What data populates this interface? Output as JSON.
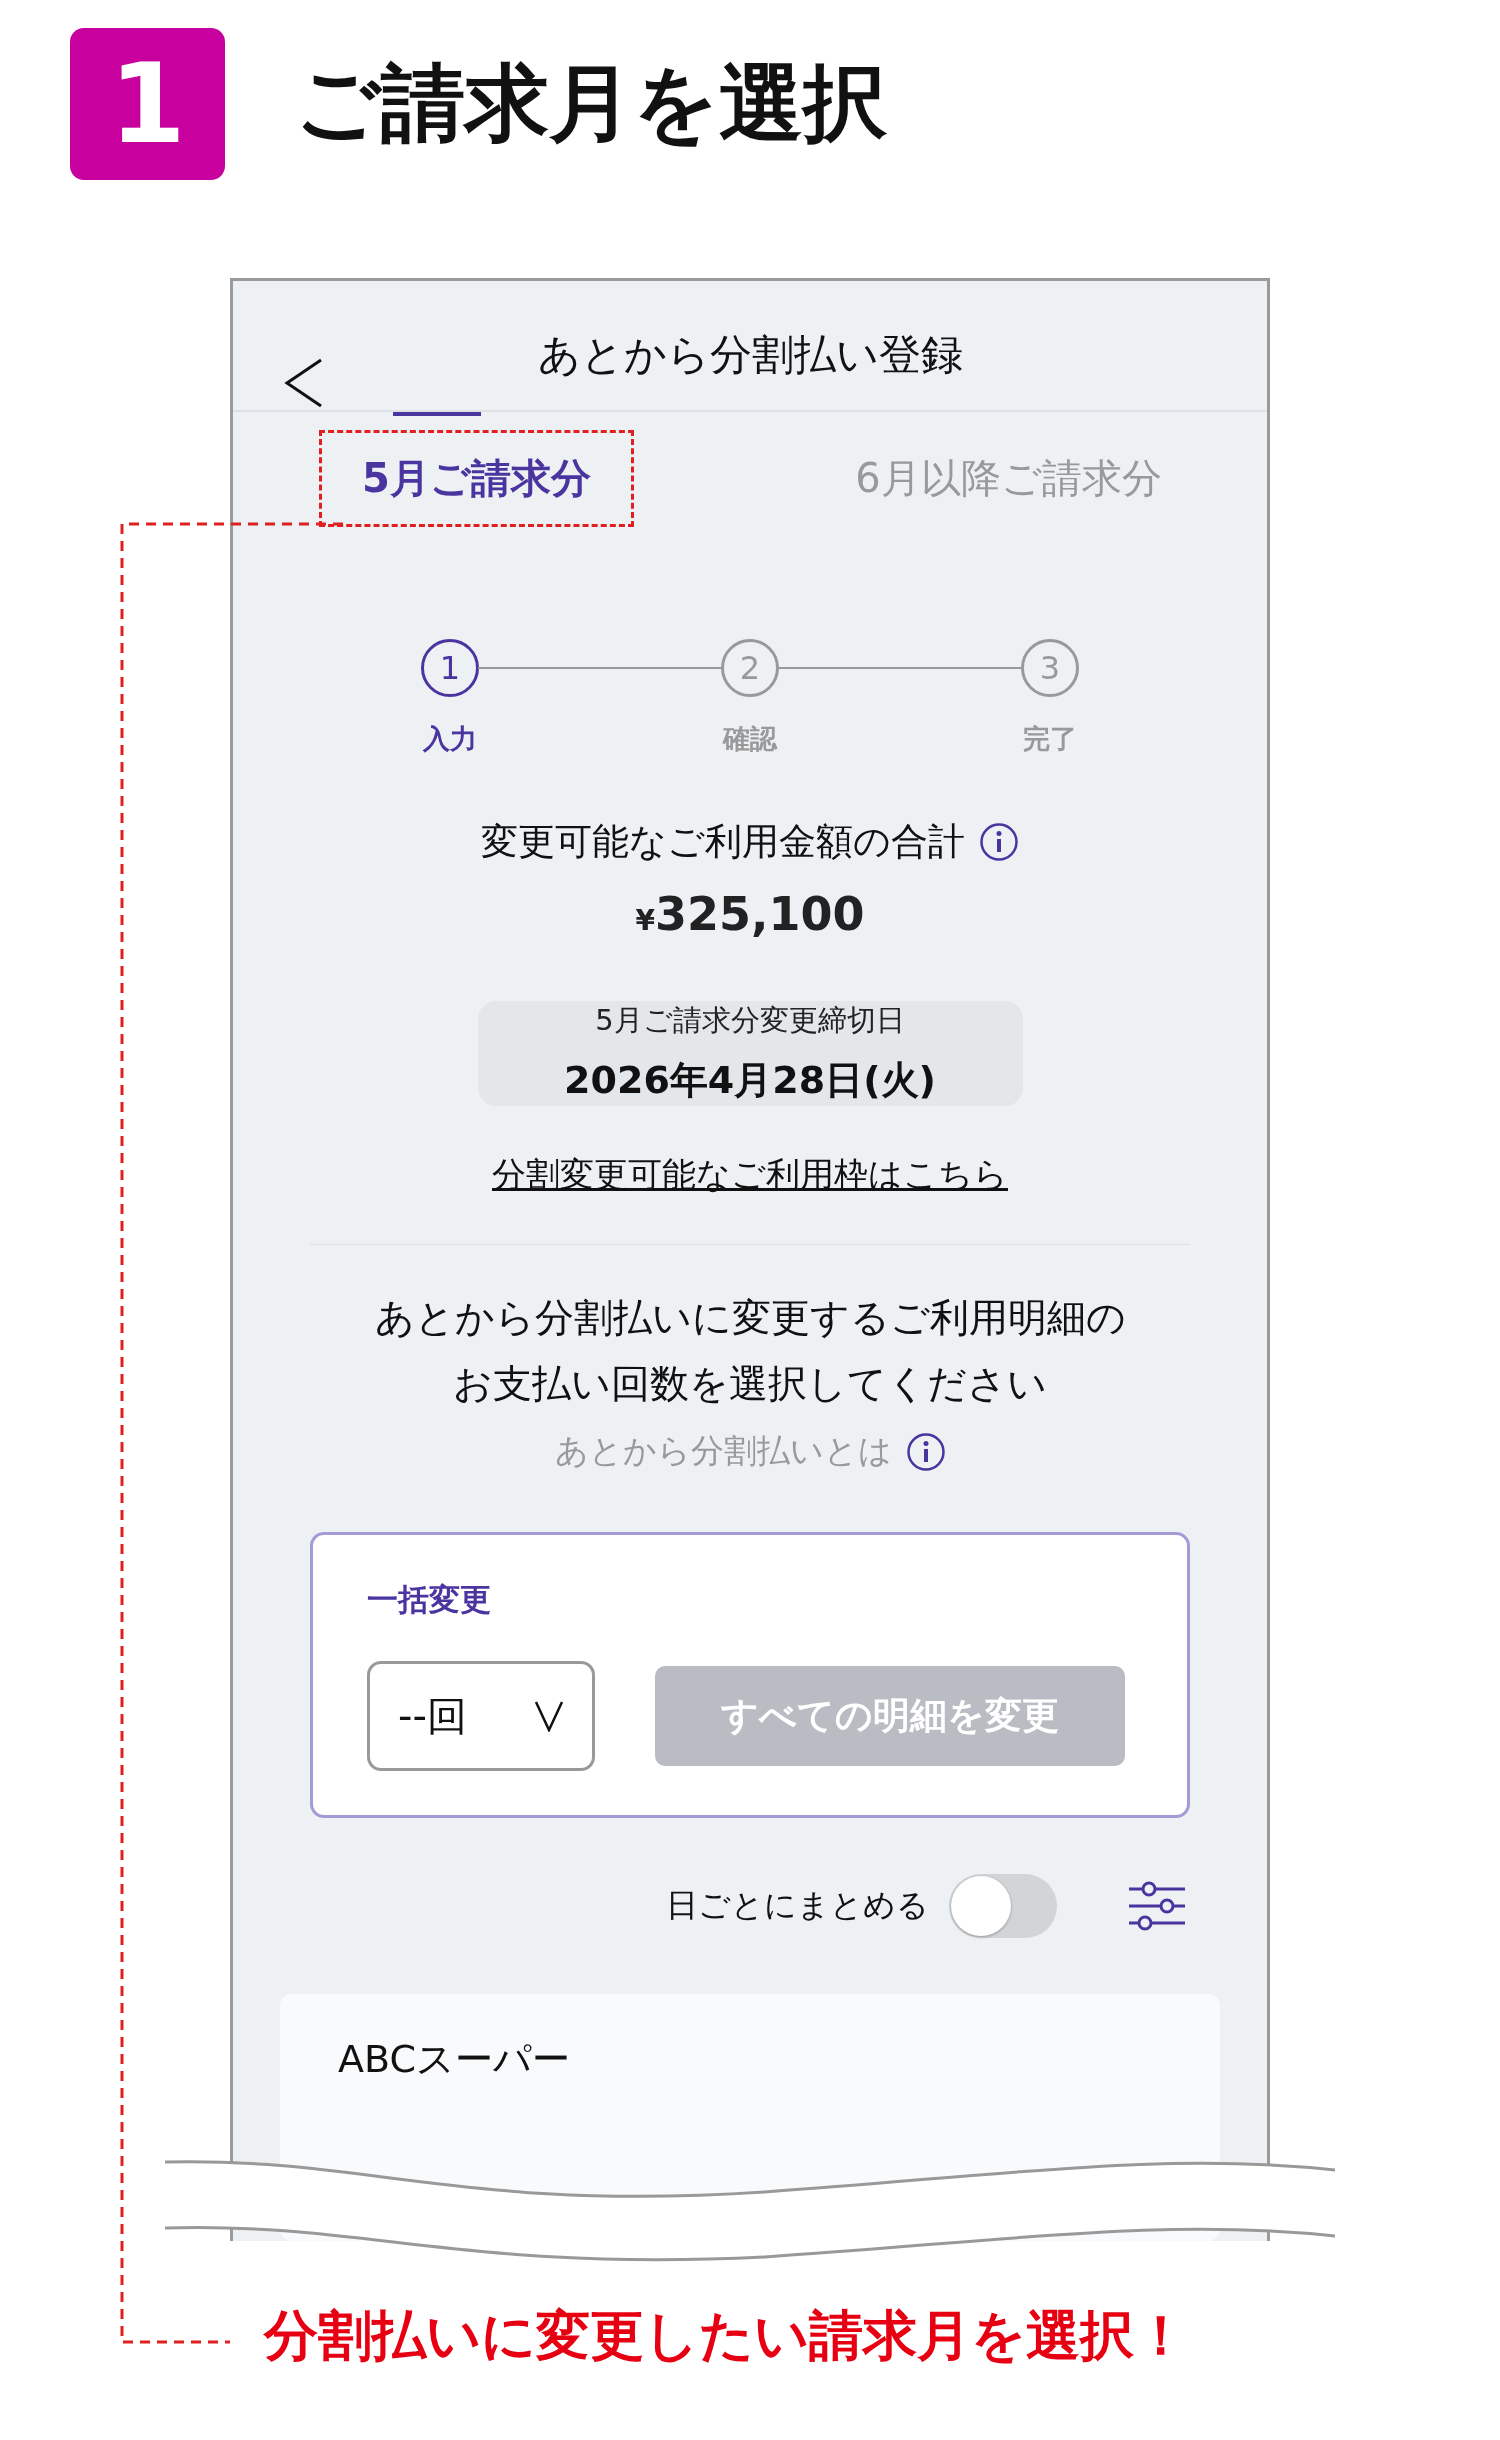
{
  "step_badge": "1",
  "heading": "ご請求月を選択",
  "app": {
    "title": "あとから分割払い登録",
    "tabs": [
      {
        "label": "5月ご請求分",
        "selected": true,
        "highlighted": true
      },
      {
        "label": "6月以降ご請求分",
        "selected": false,
        "highlighted": false
      }
    ],
    "steps": [
      {
        "number": "1",
        "label": "入力",
        "selected": true
      },
      {
        "number": "2",
        "label": "確認",
        "selected": false
      },
      {
        "number": "3",
        "label": "完了",
        "selected": false
      }
    ],
    "total": {
      "label": "変更可能なご利用金額の合計",
      "currency": "¥",
      "amount": "325,100"
    },
    "deadline": {
      "label": "5月ご請求分変更締切日",
      "date": "2026年4月28日(火)"
    },
    "limit_link": "分割変更可能なご利用枠はこちら",
    "instruction": [
      "あとから分割払いに変更するご利用明細の",
      "お支払い回数を選択してください"
    ],
    "about_link": "あとから分割払いとは",
    "bulk": {
      "title": "一括変更",
      "select_value": "--回",
      "button": {
        "label": "すべての明細を変更",
        "disabled": true
      }
    },
    "group_by_day": {
      "label": "日ごとにまとめる",
      "on": false
    },
    "items": [
      {
        "merchant": "ABCスーパー"
      }
    ]
  },
  "annotation": "分割払いに変更したい請求月を選択！"
}
